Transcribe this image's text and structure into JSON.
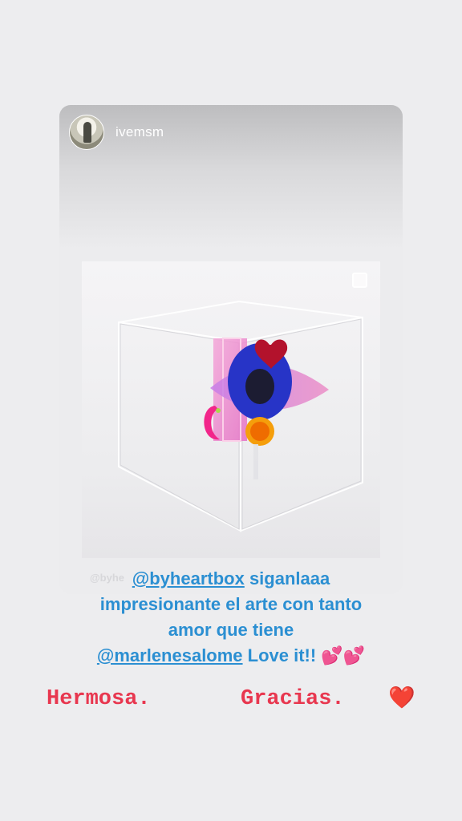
{
  "story": {
    "username": "ivemsm",
    "watermark": "@byhe",
    "caption": {
      "mention1": "@byheartbox",
      "line1_rest": " siganlaaa",
      "line2": "impresionante el arte con tanto",
      "line3": "amor que tiene",
      "mention2": "@marlenesalome",
      "line4_rest": "  Love it!! 💕💕"
    },
    "reply_left": "Hermosa.",
    "reply_right": "Gracias.",
    "heart_emoji": "❤️"
  },
  "colors": {
    "mention": "#2b8fd2",
    "reply_text": "#e8374f",
    "background": "#ededef"
  },
  "icons": [
    "avatar",
    "select-square-icon",
    "heart-emoji"
  ]
}
